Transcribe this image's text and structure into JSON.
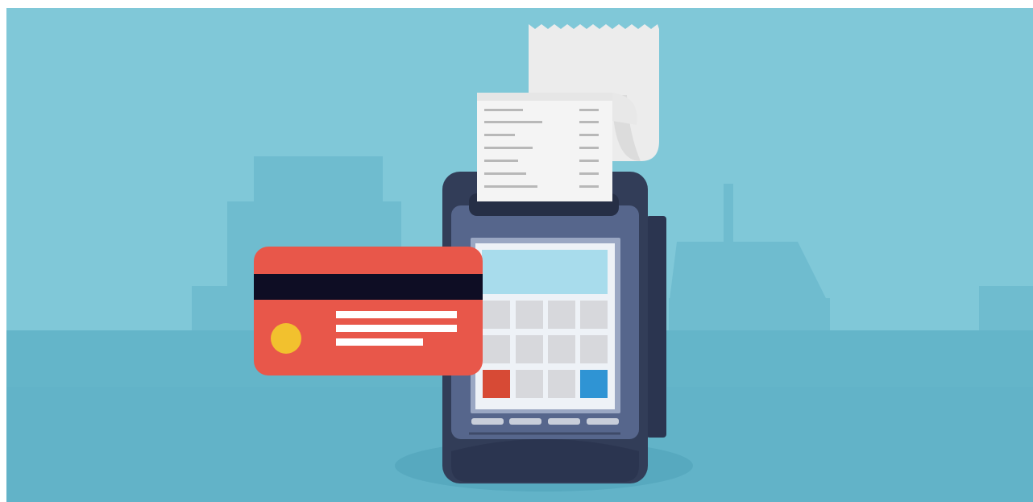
{
  "illustration": {
    "subject": "payment-terminal-with-credit-card-and-receipt",
    "icons": [
      "receipt-icon",
      "payment-terminal-icon",
      "credit-card-icon",
      "keypad-icon",
      "city-skyline-icon"
    ]
  },
  "colors": {
    "background": "#80c8d8",
    "skyline_back": "#6fbccf",
    "skyline_front": "#65b6ca",
    "ground": "#64b5c9",
    "terminal_body": "#323d58",
    "terminal_face": "#56668c",
    "terminal_bezel": "#9aa7c3",
    "screen": "#a8dcec",
    "keypad_bg": "#eef2f7",
    "key": "#d7d8dc",
    "key_red": "#d74a35",
    "key_blue": "#2f94d4",
    "receipt": "#f2f2f2",
    "receipt_lines": "#b8b8b8",
    "card": "#e8574a",
    "card_stripe": "#0e0d24",
    "card_chip": "#f2c12e",
    "card_text": "#ffffff"
  }
}
